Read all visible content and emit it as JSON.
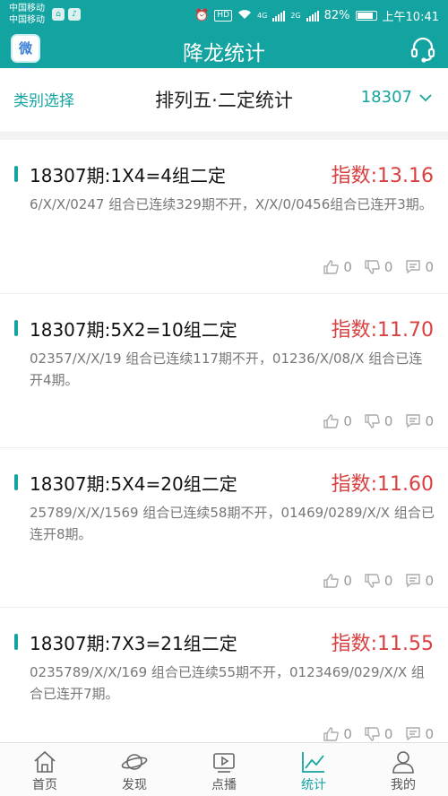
{
  "statusbar": {
    "carrier1": "中国移动",
    "carrier2": "中国移动",
    "hd": "HD",
    "net": "4G",
    "net2": "2G",
    "battery": "82%",
    "time": "上午10:41"
  },
  "app": {
    "logo_text": "微彩",
    "title": "降龙统计"
  },
  "filter": {
    "category_label": "类别选择",
    "title": "排列五·二定统计",
    "issue": "18307"
  },
  "cards": [
    {
      "title": "18307期:1X4=4组二定",
      "index": "指数:13.16",
      "desc": "6/X/X/0247 组合已连续329期不开，X/X/0/0456组合已连开3期。",
      "likes": "0",
      "dislikes": "0",
      "comments": "0"
    },
    {
      "title": "18307期:5X2=10组二定",
      "index": "指数:11.70",
      "desc": "02357/X/X/19 组合已连续117期不开，01236/X/08/X 组合已连开4期。",
      "likes": "0",
      "dislikes": "0",
      "comments": "0"
    },
    {
      "title": "18307期:5X4=20组二定",
      "index": "指数:11.60",
      "desc": "25789/X/X/1569 组合已连续58期不开，01469/0289/X/X 组合已连开8期。",
      "likes": "0",
      "dislikes": "0",
      "comments": "0"
    },
    {
      "title": "18307期:7X3=21组二定",
      "index": "指数:11.55",
      "desc": "0235789/X/X/169 组合已连续55期不开，0123469/029/X/X 组合已连开7期。",
      "likes": "0",
      "dislikes": "0",
      "comments": "0"
    }
  ],
  "tabs": [
    {
      "label": "首页",
      "icon": "home-icon"
    },
    {
      "label": "发现",
      "icon": "planet-icon"
    },
    {
      "label": "点播",
      "icon": "play-icon"
    },
    {
      "label": "统计",
      "icon": "chart-icon"
    },
    {
      "label": "我的",
      "icon": "user-icon"
    }
  ],
  "colors": {
    "brand": "#13a3a0",
    "index_red": "#d94040"
  }
}
